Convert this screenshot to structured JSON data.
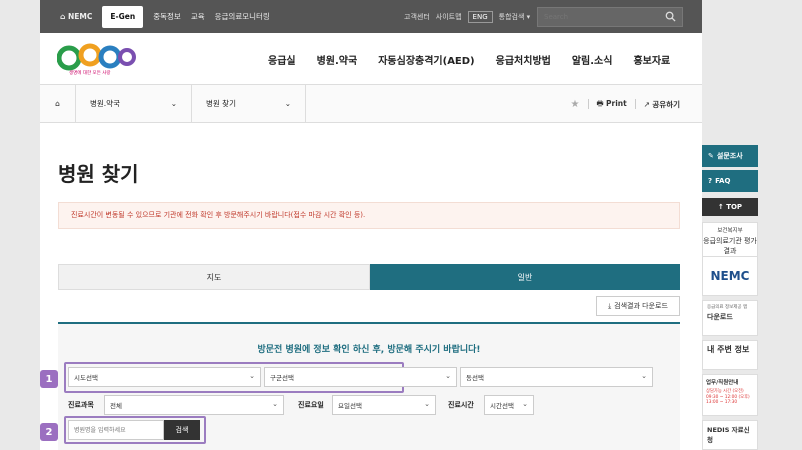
{
  "topbar": {
    "home": "NEMC",
    "active_tab": "E-Gen",
    "items": [
      "중독정보",
      "교육",
      "응급의료모니터링"
    ],
    "right": [
      "고객센터",
      "사이트맵"
    ],
    "lang": "ENG",
    "integrated_search": "통합검색 ▾",
    "search_placeholder": "Search"
  },
  "logo": {
    "text": "e-Gen",
    "tagline": "생명에 대한 모든 사랑"
  },
  "nav": [
    "응급실",
    "병원.약국",
    "자동심장충격기(AED)",
    "응급처치방법",
    "알림.소식",
    "홍보자료"
  ],
  "breadcrumb": {
    "level1": "병원.약국",
    "level2": "병원 찾기",
    "print": "Print",
    "share": "공유하기"
  },
  "page_title": "병원 찾기",
  "notice": "진료시간이 변동될 수 있으므로 기관에 전화 확인 후 방문해주시기 바랍니다(접수 마감 시간 확인 등).",
  "tabs": {
    "map": "지도",
    "general": "일반"
  },
  "download_label": "검색결과 다운로드",
  "panel_title": "방문전 병원에 정보 확인 하신 후, 방문해 주시기 바랍니다!",
  "filters": {
    "sido": "시도선택",
    "gugun": "구군선택",
    "dong": "동선택",
    "dept_label": "진료과목",
    "dept_value": "전체",
    "day_label": "진료요일",
    "day_value": "요일선택",
    "time_label": "진료시간",
    "time_value": "시간선택"
  },
  "name_placeholder": "병원명을 입력하세요",
  "search_button": "검색",
  "markers": [
    "1",
    "2"
  ],
  "sidebar": {
    "survey": "설문조사",
    "faq": "FAQ",
    "top": "↑ TOP",
    "ministry": "보건복지부",
    "eval": "응급의료기관 평가 결과",
    "nemc": "NEMC",
    "download_info": "응급의료 정보제공 앱",
    "download": "다운로드",
    "nearby": "내 주변 정보",
    "contact": "업무/직원안내",
    "contact_hours": "상담가능 시간 (오전) 09:30 ~ 12:00 (오후) 13:00 ~ 17:30",
    "nedis": "NEDIS 자료신청"
  },
  "colors": {
    "accent": "#1f6e80",
    "highlight": "#9b7cc0",
    "notice_text": "#c0392b"
  }
}
